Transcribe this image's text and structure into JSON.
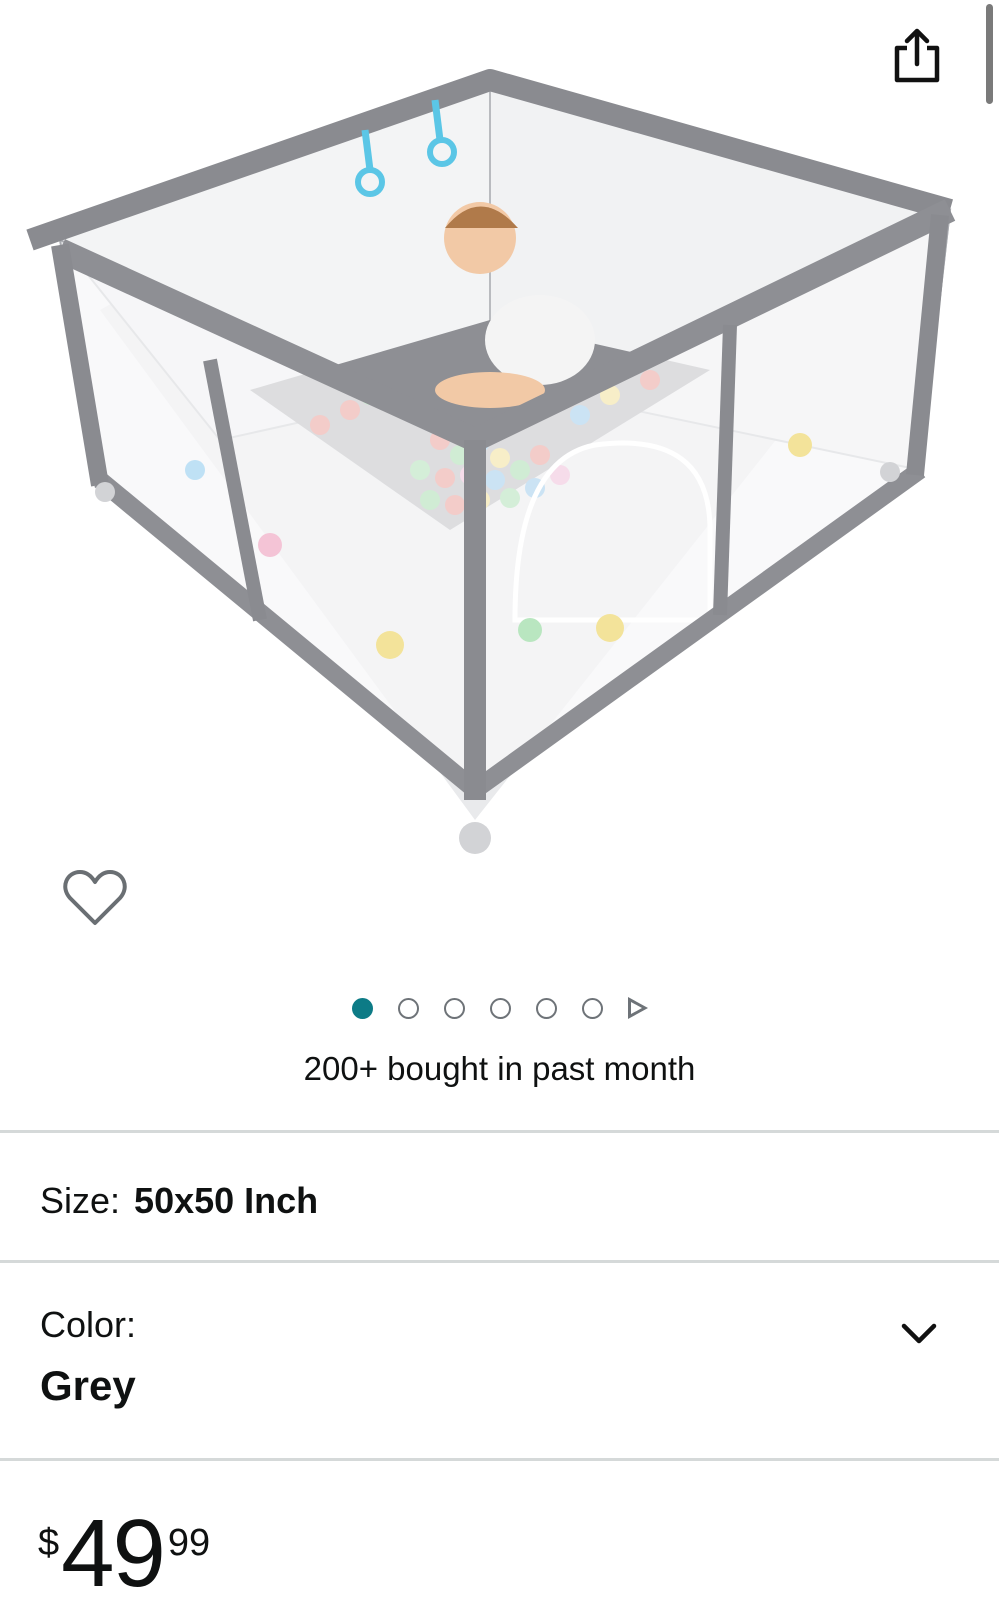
{
  "icons": {
    "share": "share-icon",
    "wishlist": "heart-icon",
    "dropdown": "chevron-down-icon",
    "next_media": "play-triangle-icon"
  },
  "colors": {
    "active_dot": "#0d7b86",
    "divider": "#d5d9d9",
    "text": "#0f1111",
    "playpen_grey": "#8e8f94"
  },
  "carousel": {
    "dots": [
      {
        "active": true
      },
      {
        "active": false
      },
      {
        "active": false
      },
      {
        "active": false
      },
      {
        "active": false
      },
      {
        "active": false
      }
    ]
  },
  "social_proof": "200+ bought in past month",
  "size": {
    "label": "Size:",
    "value": "50x50 Inch"
  },
  "color": {
    "label": "Color:",
    "value": "Grey"
  },
  "price": {
    "symbol": "$",
    "whole": "49",
    "fraction": "99"
  }
}
